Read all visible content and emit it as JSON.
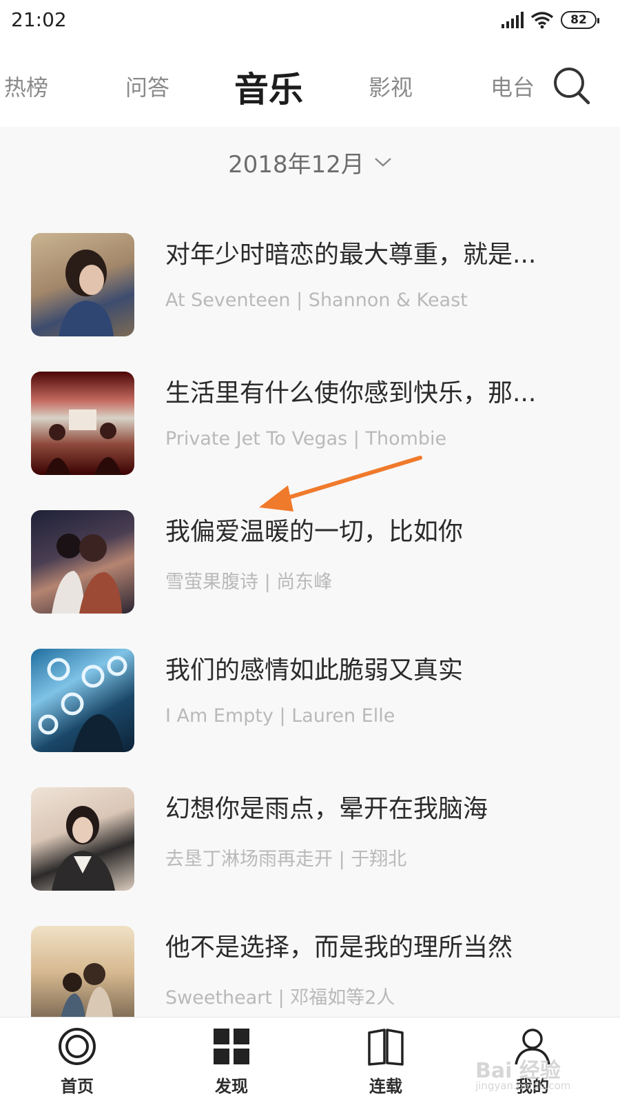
{
  "status_bar": {
    "time": "21:02",
    "battery": "82"
  },
  "tabs": [
    {
      "label": "热榜",
      "active": false
    },
    {
      "label": "问答",
      "active": false
    },
    {
      "label": "音乐",
      "active": true
    },
    {
      "label": "影视",
      "active": false
    },
    {
      "label": "电台",
      "active": false
    }
  ],
  "date_picker": {
    "label": "2018年12月"
  },
  "songs": [
    {
      "title": "对年少时暗恋的最大尊重，就是...",
      "subtitle": "At Seventeen | Shannon & Keast"
    },
    {
      "title": "生活里有什么使你感到快乐，那...",
      "subtitle": "Private Jet To Vegas | Thombie"
    },
    {
      "title": "我偏爱温暖的一切，比如你",
      "subtitle": "雪萤果腹诗 | 尚东峰"
    },
    {
      "title": "我们的感情如此脆弱又真实",
      "subtitle": "I Am Empty | Lauren Elle"
    },
    {
      "title": "幻想你是雨点，晕开在我脑海",
      "subtitle": "去垦丁淋场雨再走开 | 于翔北"
    },
    {
      "title": "他不是选择，而是我的理所当然",
      "subtitle": "Sweetheart | 邓福如等2人"
    }
  ],
  "bottom_nav": [
    {
      "label": "首页"
    },
    {
      "label": "发现"
    },
    {
      "label": "连载"
    },
    {
      "label": "我的"
    }
  ],
  "watermark": {
    "brand": "Bai 经验",
    "url": "jingyan.baidu.com"
  },
  "colors": {
    "accent_arrow": "#f07a2c",
    "text_primary": "#2b2b2b",
    "text_secondary": "#b9b9b9"
  }
}
